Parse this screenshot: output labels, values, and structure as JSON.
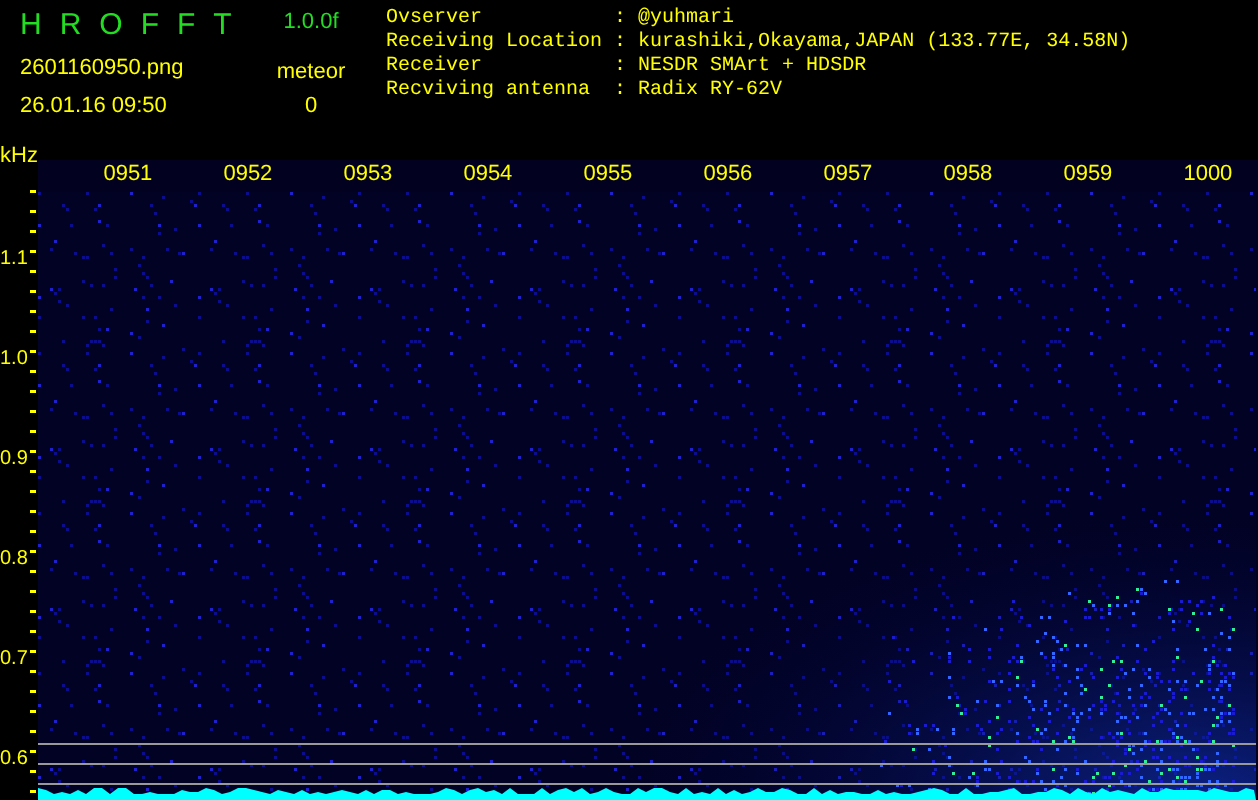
{
  "app": {
    "title": "HROFFT",
    "version": "1.0.0f",
    "filename": "2601160950.png",
    "datetime": "26.01.16 09:50",
    "counter_label": "meteor",
    "counter_value": "0"
  },
  "info": [
    {
      "label": "Ovserver",
      "sep": ":",
      "value": "@yuhmari"
    },
    {
      "label": "Receiving Location",
      "sep": ":",
      "value": "kurashiki,Okayama,JAPAN (133.77E, 34.58N)"
    },
    {
      "label": "Receiver",
      "sep": ":",
      "value": "NESDR SMArt + HDSDR"
    },
    {
      "label": "Recviving antenna",
      "sep": ":",
      "value": "Radix RY-62V"
    }
  ],
  "plot": {
    "y_unit": "kHz",
    "y_labels": [
      "1.1",
      "1.0",
      "0.9",
      "0.8",
      "0.7",
      "0.6"
    ],
    "x_labels": [
      "0951",
      "0952",
      "0953",
      "0954",
      "0955",
      "0956",
      "0957",
      "0958",
      "0959",
      "1000"
    ]
  }
}
